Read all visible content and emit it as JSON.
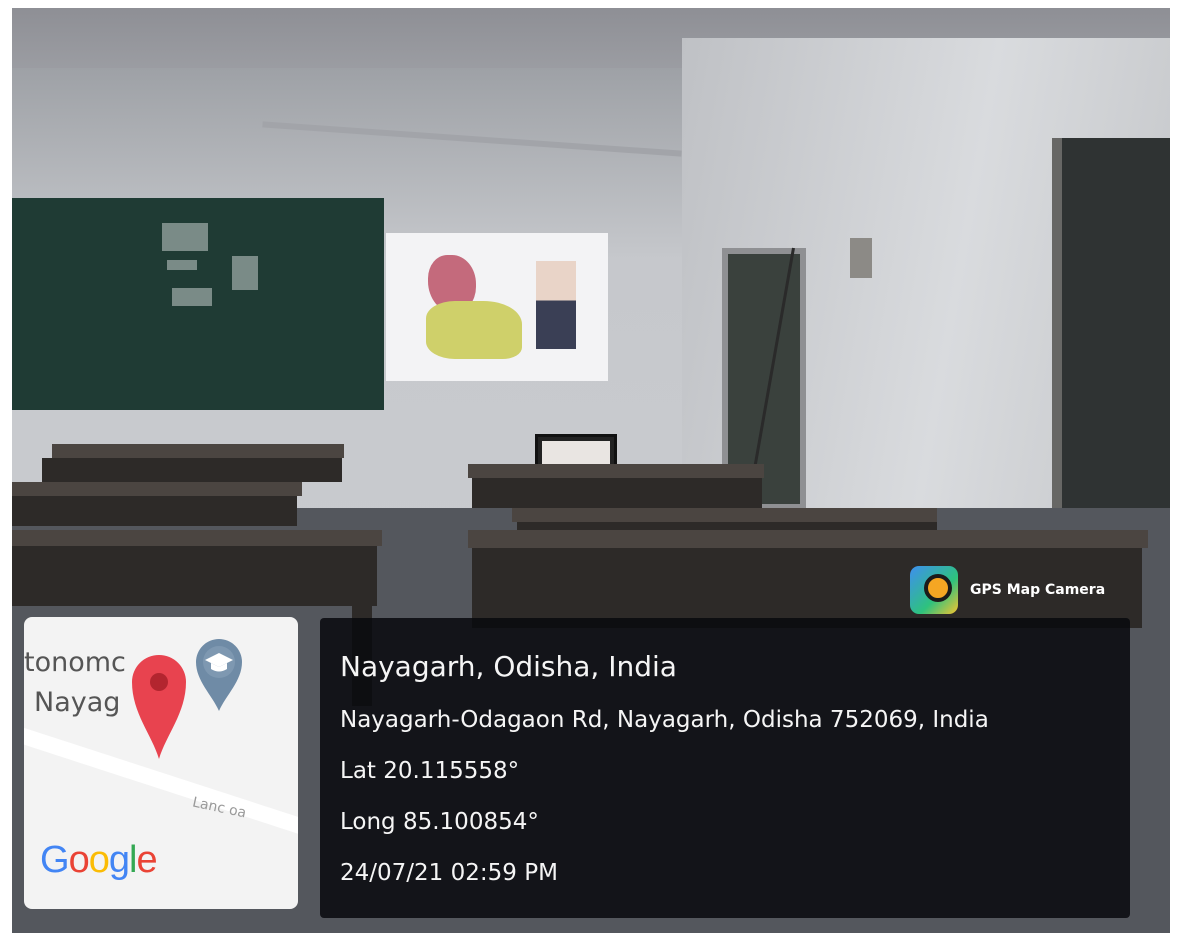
{
  "location": {
    "place": "Nayagarh, Odisha, India",
    "address": "Nayagarh-Odagaon Rd, Nayagarh, Odisha 752069, India",
    "latitude": "Lat 20.115558°",
    "longitude": "Long 85.100854°",
    "datetime": "24/07/21 02:59 PM"
  },
  "app_badge": {
    "label": "GPS Map Camera",
    "icon": "gps-map-camera-icon"
  },
  "map_thumbnail": {
    "label_line1": "tonomc",
    "label_line2": "Nayag",
    "label_faint": "Lanc  oa",
    "logo_letters": [
      "G",
      "o",
      "o",
      "g",
      "l",
      "e"
    ],
    "logo_colors": [
      "#4285F4",
      "#EA4335",
      "#FBBC05",
      "#4285F4",
      "#34A853",
      "#EA4335"
    ],
    "pin_icon": "red-location-pin-icon",
    "school_icon": "graduation-cap-pin-icon"
  },
  "colors": {
    "overlay": "#0b0c12",
    "pin_red": "#E8434F",
    "school_pin": "#6F8BA6"
  }
}
